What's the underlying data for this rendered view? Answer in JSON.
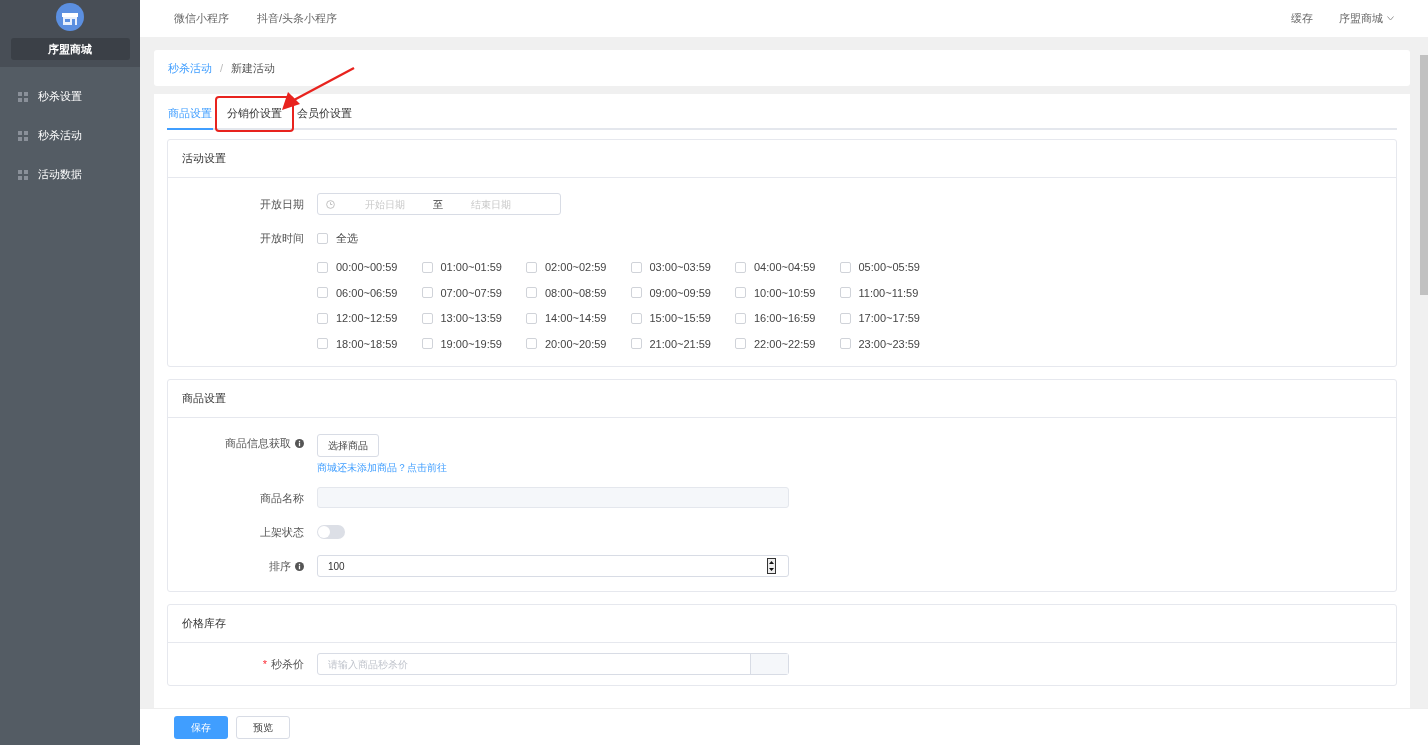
{
  "top_nav": {
    "links": [
      "微信小程序",
      "抖音/头条小程序"
    ],
    "cache": "缓存",
    "account": "序盟商城"
  },
  "sidebar": {
    "shop_name": "序盟商城",
    "items": [
      "秒杀设置",
      "秒杀活动",
      "活动数据"
    ]
  },
  "breadcrumb": [
    "秒杀活动",
    "/",
    "新建活动"
  ],
  "tabs": [
    {
      "label": "商品设置",
      "selected": true,
      "annotated": false
    },
    {
      "label": "分销价设置",
      "selected": false,
      "annotated": true
    },
    {
      "label": "会员价设置",
      "selected": false,
      "annotated": false
    }
  ],
  "activity_section": {
    "title": "活动设置",
    "date": {
      "label": "开放日期",
      "start_placeholder": "开始日期",
      "separator": "至",
      "end_placeholder": "结束日期"
    },
    "time": {
      "label": "开放时间",
      "select_all": {
        "label": "全选",
        "checked": false
      },
      "slots": [
        {
          "label": "00:00~00:59",
          "checked": false
        },
        {
          "label": "01:00~01:59",
          "checked": false
        },
        {
          "label": "02:00~02:59",
          "checked": false
        },
        {
          "label": "03:00~03:59",
          "checked": false
        },
        {
          "label": "04:00~04:59",
          "checked": false
        },
        {
          "label": "05:00~05:59",
          "checked": false
        },
        {
          "label": "06:00~06:59",
          "checked": false
        },
        {
          "label": "07:00~07:59",
          "checked": false
        },
        {
          "label": "08:00~08:59",
          "checked": false
        },
        {
          "label": "09:00~09:59",
          "checked": false
        },
        {
          "label": "10:00~10:59",
          "checked": false
        },
        {
          "label": "11:00~11:59",
          "checked": false
        },
        {
          "label": "12:00~12:59",
          "checked": false
        },
        {
          "label": "13:00~13:59",
          "checked": false
        },
        {
          "label": "14:00~14:59",
          "checked": false
        },
        {
          "label": "15:00~15:59",
          "checked": false
        },
        {
          "label": "16:00~16:59",
          "checked": false
        },
        {
          "label": "17:00~17:59",
          "checked": false
        },
        {
          "label": "18:00~18:59",
          "checked": false
        },
        {
          "label": "19:00~19:59",
          "checked": false
        },
        {
          "label": "20:00~20:59",
          "checked": false
        },
        {
          "label": "21:00~21:59",
          "checked": false
        },
        {
          "label": "22:00~22:59",
          "checked": false
        },
        {
          "label": "23:00~23:59",
          "checked": false
        }
      ]
    }
  },
  "goods_section": {
    "title": "商品设置",
    "info": {
      "label": "商品信息获取",
      "button": "选择商品",
      "hint": "商城还未添加商品？",
      "link": "点击前往"
    },
    "name": {
      "label": "商品名称"
    },
    "status": {
      "label": "上架状态",
      "on": false
    },
    "sort": {
      "label": "排序",
      "value": "100"
    }
  },
  "price_section": {
    "title": "价格库存",
    "price": {
      "required_mark": "*",
      "label": "秒杀价",
      "placeholder": "请输入商品秒杀价"
    }
  },
  "footer": {
    "save": "保存",
    "preview": "预览"
  }
}
